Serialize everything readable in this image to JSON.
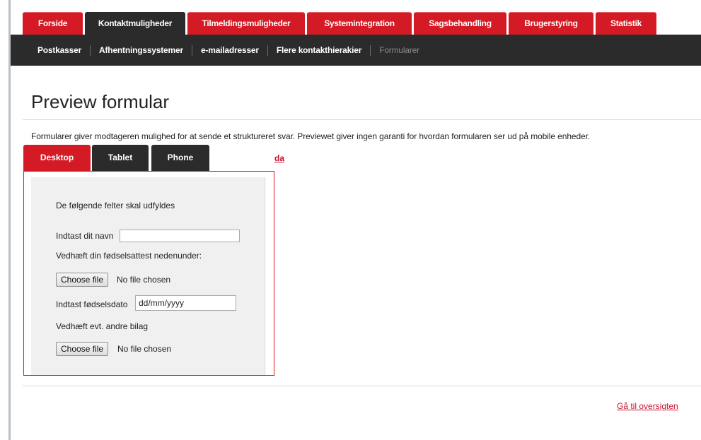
{
  "top_tabs": [
    {
      "label": "Forside",
      "active": false
    },
    {
      "label": "Kontaktmuligheder",
      "active": true
    },
    {
      "label": "Tilmeldingsmuligheder",
      "active": false
    },
    {
      "label": "Systemintegration",
      "active": false
    },
    {
      "label": "Sagsbehandling",
      "active": false
    },
    {
      "label": "Brugerstyring",
      "active": false
    },
    {
      "label": "Statistik",
      "active": false
    }
  ],
  "subnav": [
    {
      "label": "Postkasser",
      "current": false
    },
    {
      "label": "Afhentningssystemer",
      "current": false
    },
    {
      "label": "e-mailadresser",
      "current": false
    },
    {
      "label": "Flere kontakthierakier",
      "current": false
    },
    {
      "label": "Formularer",
      "current": true
    }
  ],
  "page": {
    "title": "Preview formular",
    "description": "Formularer giver modtageren mulighed for at sende et struktureret svar. Previewet giver ingen garanti for hvordan formularen ser ud på mobile enheder."
  },
  "device_tabs": {
    "desktop": "Desktop",
    "tablet": "Tablet",
    "phone": "Phone",
    "active": "Desktop"
  },
  "language_link": "da",
  "form": {
    "intro": "De følgende felter skal udfyldes",
    "name_label": "Indtast dit navn",
    "name_value": "",
    "birth_certificate_label": "Vedhæft din fødselsattest nedenunder:",
    "file_button_1": "Choose file",
    "file_status_1": "No file chosen",
    "birthdate_label": "Indtast fødselsdato",
    "birthdate_placeholder": "dd/mm/yyyy",
    "attachments_label": "Vedhæft evt. andre bilag",
    "file_button_2": "Choose file",
    "file_status_2": "No file chosen"
  },
  "footer": {
    "overview_link": "Gå til oversigten"
  },
  "colors": {
    "brand_red": "#d41a24",
    "dark_bar": "#2b2b2b",
    "link_red": "#c8102e"
  }
}
